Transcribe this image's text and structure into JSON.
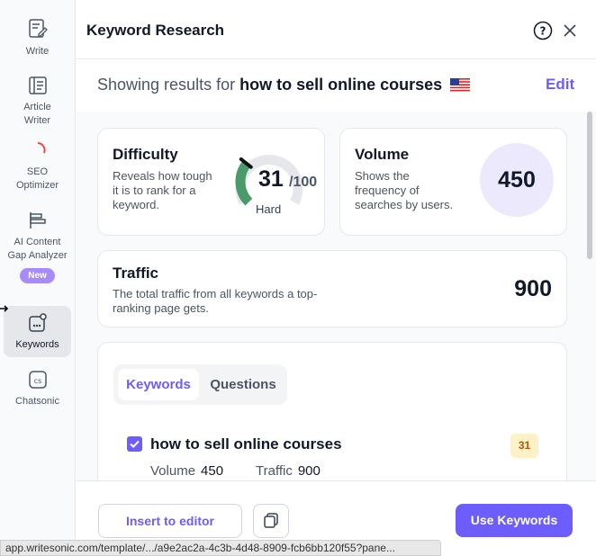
{
  "sidebar": {
    "items": [
      {
        "label": "Write",
        "icon": "write-icon"
      },
      {
        "label": "Article Writer",
        "icon": "article-writer-icon"
      },
      {
        "label": "SEO Optimizer",
        "icon": "seo-optimizer-icon"
      },
      {
        "label": "AI Content Gap Analyzer",
        "icon": "content-gap-icon",
        "badge": "New"
      },
      {
        "label": "Keywords",
        "icon": "keywords-icon",
        "active": true
      },
      {
        "label": "Chatsonic",
        "icon": "chatsonic-icon"
      }
    ]
  },
  "panel": {
    "title": "Keyword Research",
    "help_icon": "help-icon",
    "close_icon": "close-icon"
  },
  "results": {
    "prefix": "Showing results for",
    "query": "how to sell online courses",
    "flag": "us-flag-icon",
    "edit_label": "Edit"
  },
  "difficulty": {
    "title": "Difficulty",
    "description": "Reveals how tough it is to rank for a keyword.",
    "value": "31",
    "max": "/100",
    "level": "Hard",
    "fraction": 0.31
  },
  "volume": {
    "title": "Volume",
    "description": "Shows the frequency of searches by users.",
    "value": "450"
  },
  "traffic": {
    "title": "Traffic",
    "description": "The total traffic from all keywords a top-ranking page gets.",
    "value": "900"
  },
  "keywords_section": {
    "tabs": [
      "Keywords",
      "Questions"
    ],
    "active_tab": "Keywords",
    "items": [
      {
        "keyword": "how to sell online courses",
        "checked": true,
        "difficulty": "31",
        "volume_label": "Volume",
        "volume": "450",
        "traffic_label": "Traffic",
        "traffic": "900"
      }
    ]
  },
  "footer": {
    "insert_label": "Insert to editor",
    "copy_icon": "copy-icon",
    "use_label": "Use Keywords"
  },
  "status_url": "app.writesonic.com/template/.../a9e2ac2a-4c3b-4d48-8909-fcb6bb120f55?pane...",
  "colors": {
    "accent": "#6d5dfc",
    "gauge_fill": "#4a9a6a",
    "badge_bg": "#fdf1c7",
    "volume_circle": "#ece9fd"
  }
}
